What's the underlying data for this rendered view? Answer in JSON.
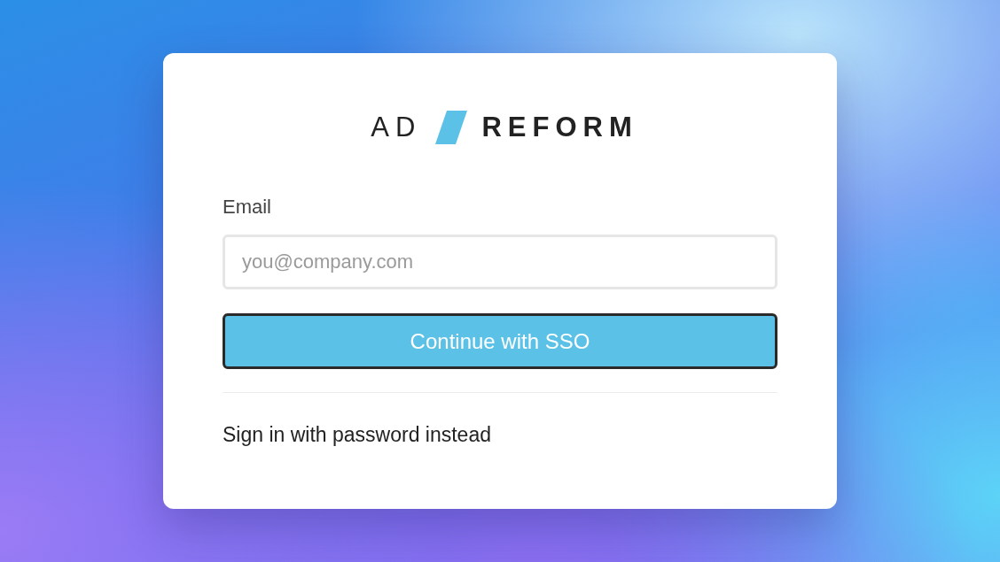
{
  "logo": {
    "light_text": "AD",
    "bold_text": "REFORM"
  },
  "email": {
    "label": "Email",
    "placeholder": "you@company.com"
  },
  "sso_button": {
    "label": "Continue with SSO"
  },
  "password_link": {
    "label": "Sign in with password instead"
  }
}
